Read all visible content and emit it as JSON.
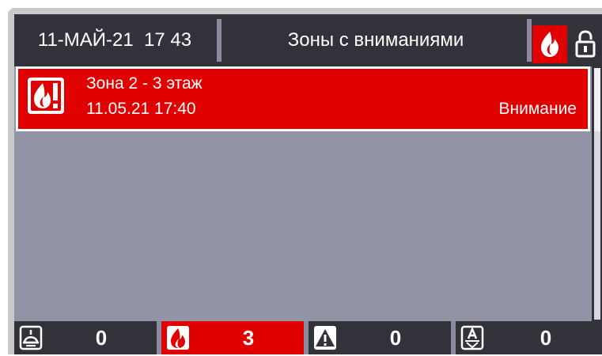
{
  "header": {
    "datetime": "11-МАЙ-21  17 43",
    "title": "Зоны с вниманиями",
    "fire_icon": "fire-icon",
    "lock_icon": "unlocked-lock-icon"
  },
  "alerts": [
    {
      "icon": "fire-alarm-icon",
      "zone": "Зона 2 - 3 этаж",
      "time": "11.05.21 17:40",
      "status": "Внимание"
    }
  ],
  "footer": {
    "counters": [
      {
        "icon": "detector-icon",
        "count": "0",
        "active": false
      },
      {
        "icon": "fire-icon",
        "count": "3",
        "active": true
      },
      {
        "icon": "warning-triangle-icon",
        "count": "0",
        "active": false
      },
      {
        "icon": "alarm-device-icon",
        "count": "0",
        "active": false
      }
    ]
  },
  "colors": {
    "alarm_red": "#e10000",
    "panel_dark": "#32323a",
    "list_background": "#9294a6",
    "separator": "#8b8ba0"
  }
}
